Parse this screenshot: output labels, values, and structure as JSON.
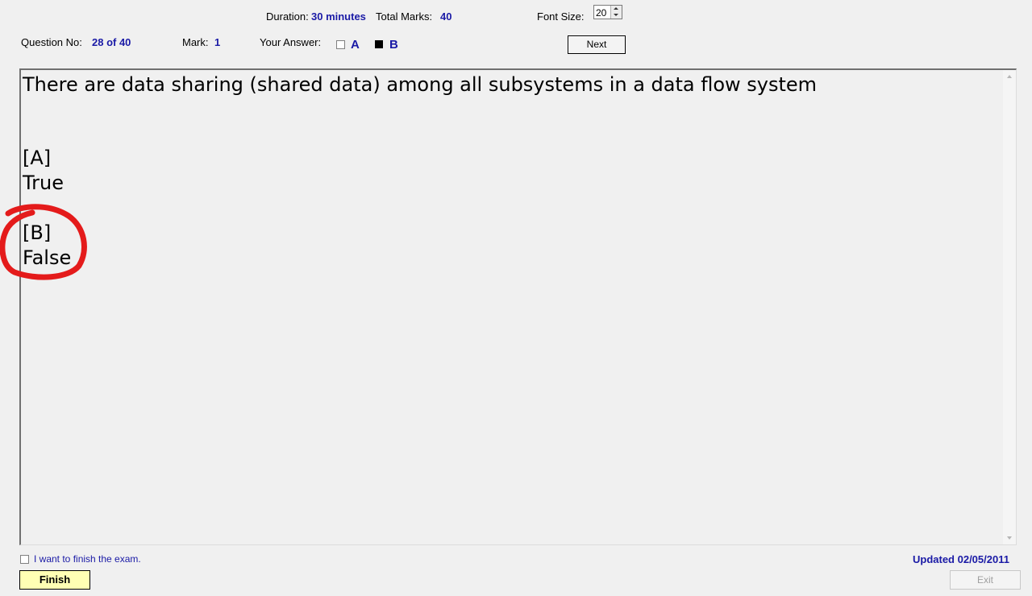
{
  "header": {
    "duration_label": "Duration:",
    "duration_value": "30 minutes",
    "total_marks_label": "Total Marks:",
    "total_marks_value": "40",
    "font_size_label": "Font Size:",
    "font_size_value": "20",
    "question_no_label": "Question No:",
    "question_no_value": "28 of 40",
    "mark_label": "Mark:",
    "mark_value": "1",
    "your_answer_label": "Your Answer:",
    "answer_options": [
      {
        "letter": "A",
        "checked": false
      },
      {
        "letter": "B",
        "checked": true
      }
    ],
    "next_label": "Next"
  },
  "question": {
    "text": "There are data sharing (shared data) among all subsystems in a data flow system",
    "options": [
      {
        "key": "[A]",
        "text": "True"
      },
      {
        "key": "[B]",
        "text": "False"
      }
    ],
    "annotation": {
      "color": "#e41b1b",
      "target_option": "B"
    }
  },
  "footer": {
    "finish_checkbox_label": "I want to finish the exam.",
    "finish_checkbox_checked": false,
    "finish_label": "Finish",
    "updated_text": "Updated 02/05/2011",
    "exit_label": "Exit"
  }
}
